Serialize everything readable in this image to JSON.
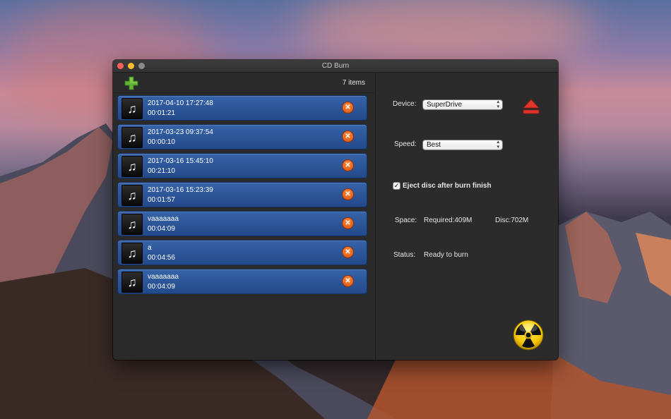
{
  "window": {
    "title": "CD Burn"
  },
  "list": {
    "count_label": "7 items",
    "items": [
      {
        "name": "2017-04-10 17:27:48",
        "duration": "00:01:21"
      },
      {
        "name": "2017-03-23 09:37:54",
        "duration": "00:00:10"
      },
      {
        "name": "2017-03-16 15:45:10",
        "duration": "00:21:10"
      },
      {
        "name": "2017-03-16 15:23:39",
        "duration": "00:01:57"
      },
      {
        "name": "vaaaaaaa",
        "duration": "00:04:09"
      },
      {
        "name": "a",
        "duration": "00:04:56"
      },
      {
        "name": "vaaaaaaa",
        "duration": "00:04:09"
      }
    ]
  },
  "settings": {
    "device_label": "Device:",
    "device_value": "SuperDrive",
    "speed_label": "Speed:",
    "speed_value": "Best",
    "eject_checkbox_label": "Eject disc after burn finish",
    "eject_checked": true,
    "space_label": "Space:",
    "space_required": "Required:409M",
    "space_disc": "Disc:702M",
    "status_label": "Status:",
    "status_value": "Ready to burn"
  },
  "icons": {
    "add": "plus-icon",
    "track": "music-note-icon",
    "remove": "close-icon",
    "eject": "eject-icon",
    "burn": "radiation-icon"
  },
  "colors": {
    "row_blue": "#2d5598",
    "remove_orange": "#e8601a",
    "eject_red": "#e0342a",
    "burn_yellow": "#f5c400",
    "add_green": "#5fb233"
  }
}
